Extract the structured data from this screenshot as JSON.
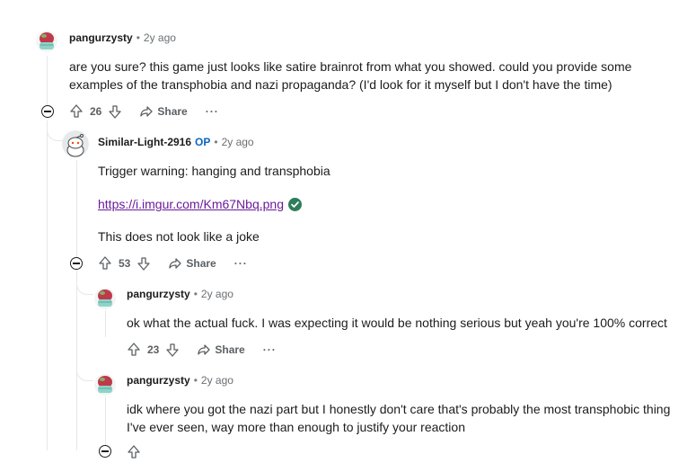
{
  "comments": [
    {
      "author": "pangurzysty",
      "time": "2y ago",
      "body_line1": "are you sure? this game just looks like satire brainrot from what you showed. could you provide some",
      "body_line2": "examples of the transphobia and nazi propaganda? (I'd look for it myself but I don't have the time)",
      "score": "26",
      "share_label": "Share",
      "more_label": "···"
    },
    {
      "author": "Similar-Light-2916",
      "op_badge": "OP",
      "time": "2y ago",
      "line1": "Trigger warning: hanging and transphobia",
      "link_text": "https://i.imgur.com/Km67Nbq.png",
      "line3": "This does not look like a joke",
      "score": "53",
      "share_label": "Share",
      "more_label": "···"
    },
    {
      "author": "pangurzysty",
      "time": "2y ago",
      "body": "ok what the actual fuck. I was expecting it would be nothing serious but yeah you're 100% correct",
      "score": "23",
      "share_label": "Share",
      "more_label": "···"
    },
    {
      "author": "pangurzysty",
      "time": "2y ago",
      "body_line1": "idk where you got the nazi part but I honestly don't care that's probably the most transphobic thing",
      "body_line2": "I've ever seen, way more than enough to justify your reaction"
    }
  ],
  "colors": {
    "op_badge": "#0a66c2",
    "link": "#6a1b9a",
    "verified_badge": "#2e7d5b"
  },
  "icons": {
    "upvote": "arrow-up-icon",
    "downvote": "arrow-down-icon",
    "share": "share-arrow-icon",
    "collapse": "minus-circle-icon",
    "verified": "check-circle-icon"
  }
}
